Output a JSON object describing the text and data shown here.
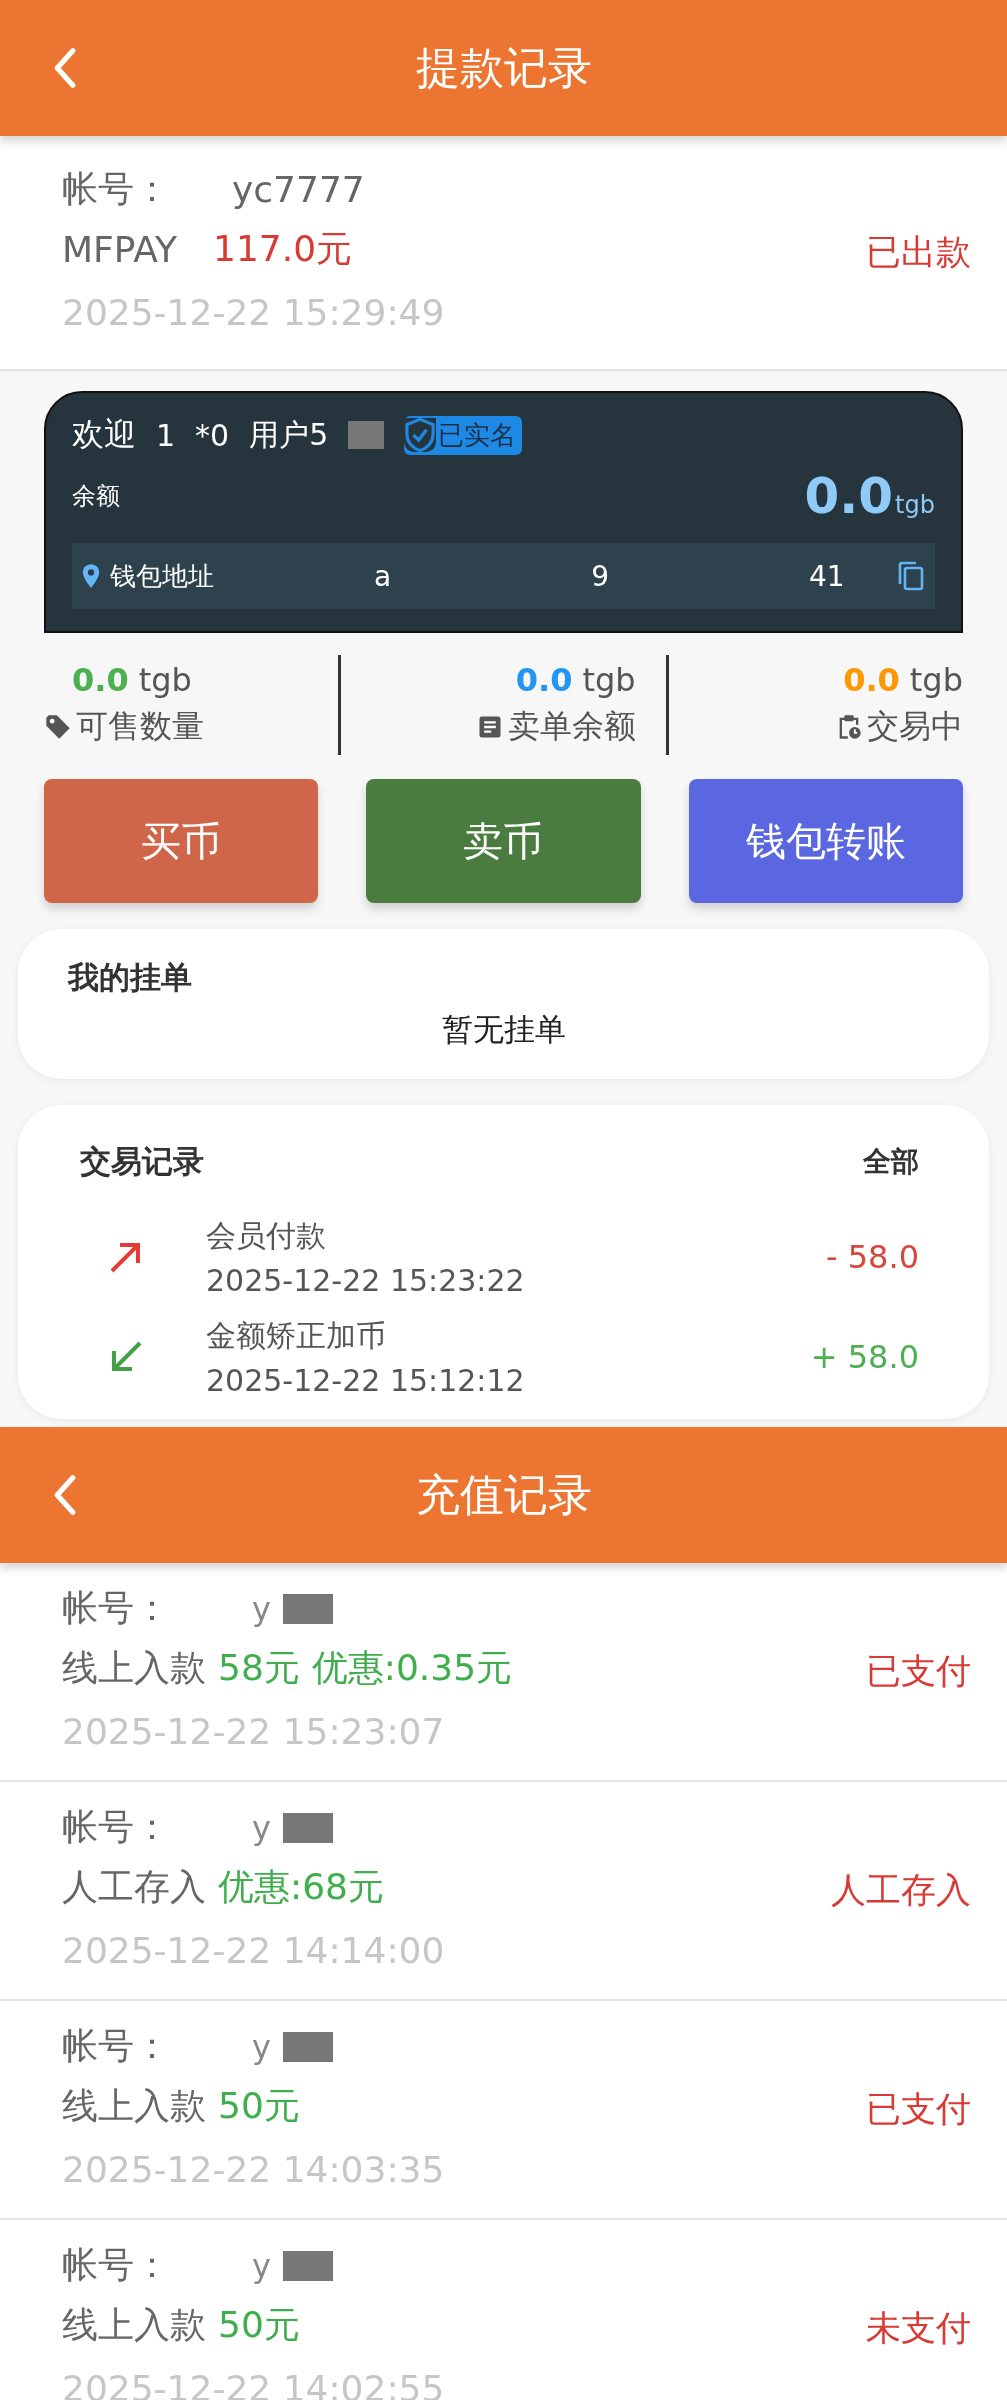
{
  "withdraw_header": {
    "title": "提款记录"
  },
  "withdraw_records": [
    {
      "account_label": "帐号：",
      "account": "yc7777",
      "method": "MFPAY",
      "amount": "117.0元",
      "status": "已出款",
      "time": "2025-12-22 15:29:49"
    }
  ],
  "wallet": {
    "welcome": "欢迎",
    "user_fragments": [
      "1",
      "*0",
      "用户5"
    ],
    "verified": "已实名",
    "balance_label": "余额",
    "balance": "0.0",
    "balance_unit": "tgb",
    "address_label": "钱包地址",
    "address_fragments": [
      "a",
      "9",
      "41"
    ]
  },
  "stats": [
    {
      "value": "0.0",
      "unit": "tgb",
      "label": "可售数量",
      "color": "#4caf50",
      "kind": "tag"
    },
    {
      "value": "0.0",
      "unit": "tgb",
      "label": "卖单余额",
      "color": "#2196f3",
      "kind": "doc"
    },
    {
      "value": "0.0",
      "unit": "tgb",
      "label": "交易中",
      "color": "#ff9800",
      "kind": "clipboard"
    }
  ],
  "actions": [
    {
      "label": "买币",
      "color": "#cf664a"
    },
    {
      "label": "卖币",
      "color": "#4a7c3f"
    },
    {
      "label": "钱包转账",
      "color": "#5b67e0"
    }
  ],
  "orders": {
    "title": "我的挂单",
    "empty": "暂无挂单"
  },
  "transactions": {
    "title": "交易记录",
    "more": "全部",
    "items": [
      {
        "kind": "out",
        "name": "会员付款",
        "time": "2025-12-22 15:23:22",
        "amount": "- 58.0"
      },
      {
        "kind": "in",
        "name": "金额矫正加币",
        "time": "2025-12-22 15:12:12",
        "amount": "+ 58.0"
      }
    ]
  },
  "recharge_header": {
    "title": "充值记录"
  },
  "recharge_records": [
    {
      "account_label": "帐号：",
      "account": "y",
      "method": "线上入款",
      "amount": "58元",
      "bonus": "优惠:0.35元",
      "status": "已支付",
      "time": "2025-12-22 15:23:07"
    },
    {
      "account_label": "帐号：",
      "account": "y",
      "method": "人工存入",
      "bonus": "优惠:68元",
      "status": "人工存入",
      "time": "2025-12-22 14:14:00"
    },
    {
      "account_label": "帐号：",
      "account": "y",
      "method": "线上入款",
      "amount": "50元",
      "status": "已支付",
      "time": "2025-12-22 14:03:35"
    },
    {
      "account_label": "帐号：",
      "account": "y",
      "method": "线上入款",
      "amount": "50元",
      "status": "未支付",
      "time": "2025-12-22 14:02:55"
    }
  ]
}
